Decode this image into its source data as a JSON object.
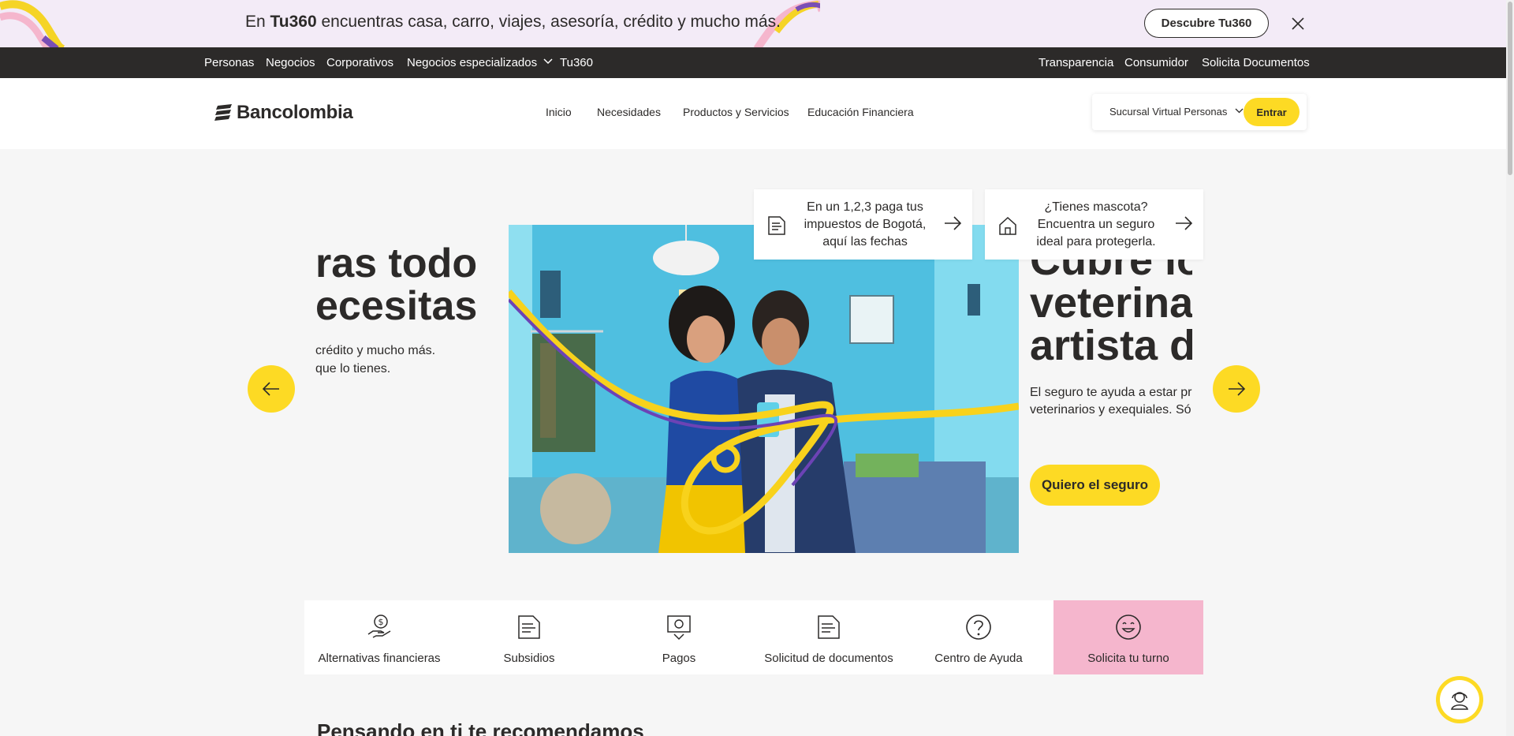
{
  "promo": {
    "prefix": "En ",
    "brand": "Tu360",
    "suffix": " encuentras casa, carro, viajes, asesoría, crédito y mucho más.",
    "button": "Descubre Tu360"
  },
  "topnav": {
    "left": [
      "Personas",
      "Negocios",
      "Corporativos",
      "Negocios especializados",
      "Tu360"
    ],
    "right": [
      "Transparencia",
      "Consumidor",
      "Solicita Documentos"
    ]
  },
  "header": {
    "logo": "Bancolombia",
    "nav": [
      "Inicio",
      "Necesidades",
      "Productos y Servicios",
      "Educación Financiera"
    ],
    "sucursal": "Sucursal Virtual Personas",
    "entrar": "Entrar"
  },
  "carousel": {
    "left": {
      "title_line1": "ras todo",
      "title_line2": "ecesitas",
      "text_line1": "crédito y mucho más.",
      "text_line2": "que lo tienes."
    },
    "right": {
      "title_line1": "Cubre lo",
      "title_line2": "veterina",
      "title_line3": "artista d",
      "text_line1": "El seguro te ayuda a estar pr",
      "text_line2": "veterinarios y exequiales. Só",
      "cta": "Quiero el seguro"
    }
  },
  "notices": [
    {
      "text": "En un 1,2,3 paga tus impuestos de Bogotá, aquí las fechas",
      "icon": "document-icon"
    },
    {
      "text": "¿Tienes mascota? Encuentra un seguro ideal para protegerla.",
      "icon": "house-icon"
    }
  ],
  "quick": [
    {
      "label": "Alternativas financieras",
      "icon": "money-hand-icon"
    },
    {
      "label": "Subsidios",
      "icon": "document-icon"
    },
    {
      "label": "Pagos",
      "icon": "payment-icon"
    },
    {
      "label": "Solicitud de documentos",
      "icon": "document-icon"
    },
    {
      "label": "Centro de Ayuda",
      "icon": "question-icon"
    },
    {
      "label": "Solicita tu turno",
      "icon": "smile-icon"
    }
  ],
  "section_title": "Pensando en ti te recomendamos",
  "colors": {
    "yellow": "#fdda24",
    "dark": "#2c2a29",
    "pink": "#f5b6cd",
    "promo_bg": "#f3ebf7"
  }
}
